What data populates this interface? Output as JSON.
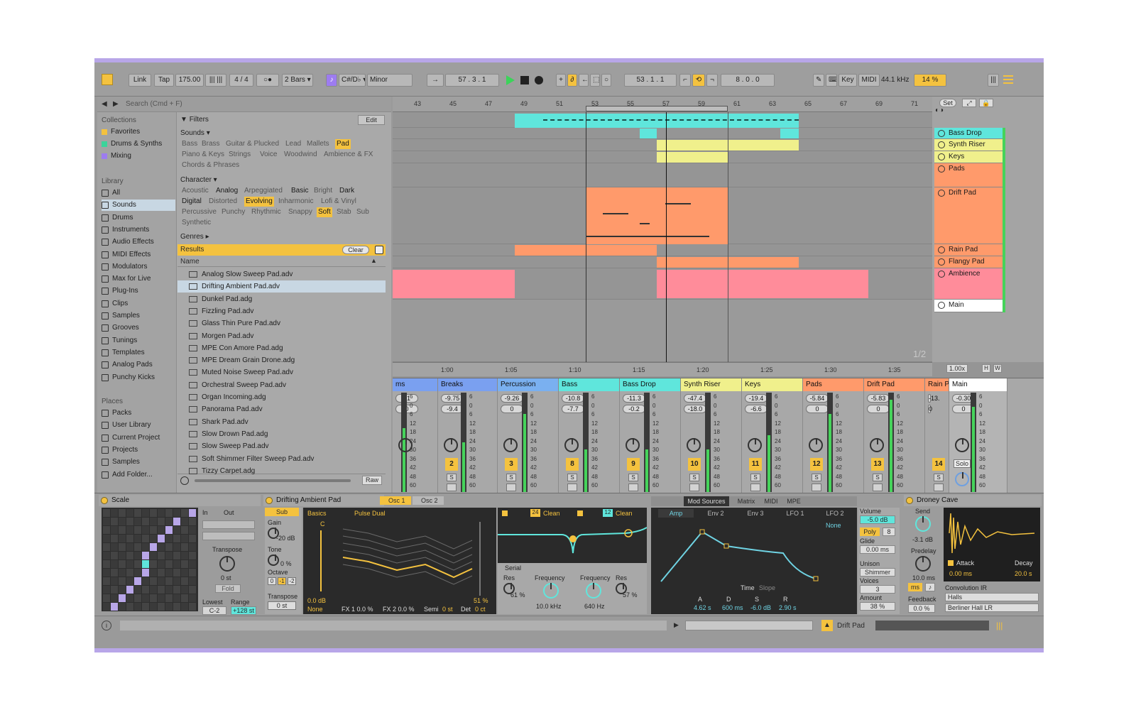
{
  "toolbar": {
    "link": "Link",
    "tap": "Tap",
    "tempo": "175.00",
    "signature": "4 / 4",
    "metronome": "○●",
    "quantize": "2 Bars ▾",
    "key_root": "C#/D♭ ▾",
    "key_mode": "Minor",
    "position": "57 .   3 .   1",
    "loop_start": "53 .   1 .   1",
    "loop_length": "8 .   0 .   0",
    "key_btn": "Key",
    "midi_btn": "MIDI",
    "sample_rate": "44.1 kHz",
    "cpu": "14 %"
  },
  "browser": {
    "search_placeholder": "Search (Cmd + F)",
    "collections_head": "Collections",
    "collections": [
      {
        "label": "Favorites",
        "color": "#f4c23f"
      },
      {
        "label": "Drums & Synths",
        "color": "#3cd39a"
      },
      {
        "label": "Mixing",
        "color": "#9d7cf0"
      }
    ],
    "library_head": "Library",
    "library": [
      "All",
      "Sounds",
      "Drums",
      "Instruments",
      "Audio Effects",
      "MIDI Effects",
      "Modulators",
      "Max for Live",
      "Plug-Ins",
      "Clips",
      "Samples",
      "Grooves",
      "Tunings",
      "Templates",
      "Analog Pads",
      "Punchy Kicks"
    ],
    "library_selected": "Sounds",
    "places_head": "Places",
    "places": [
      "Packs",
      "User Library",
      "Current Project",
      "Projects",
      "Samples",
      "Add Folder..."
    ],
    "filters_label": "Filters",
    "edit_label": "Edit",
    "sounds_head": "Sounds ▾",
    "sound_tags": [
      "Bass",
      "Brass",
      "Guitar & Plucked",
      "Lead",
      "Mallets",
      "Pad",
      "Piano & Keys",
      "Strings",
      "Voice",
      "Woodwind",
      "Ambience & FX",
      "Chords & Phrases"
    ],
    "character_head": "Character ▾",
    "character_tags": [
      "Acoustic",
      "Analog",
      "Arpeggiated",
      "Basic",
      "Bright",
      "Dark",
      "Digital",
      "Distorted",
      "Evolving",
      "Inharmonic",
      "Lofi & Vinyl",
      "Percussive",
      "Punchy",
      "Rhythmic",
      "Snappy",
      "Soft",
      "Stab",
      "Sub",
      "Synthetic"
    ],
    "genres_head": "Genres ▸",
    "results_label": "Results",
    "clear_label": "Clear",
    "name_col": "Name",
    "results": [
      "Analog Slow Sweep Pad.adv",
      "Drifting Ambient Pad.adv",
      "Dunkel Pad.adg",
      "Fizzling Pad.adv",
      "Glass Thin Pure Pad.adv",
      "Morgen Pad.adv",
      "MPE Con Amore Pad.adg",
      "MPE Dream Grain Drone.adg",
      "Muted Noise Sweep Pad.adv",
      "Orchestral Sweep Pad.adv",
      "Organ Incoming.adg",
      "Panorama Pad.adv",
      "Shark Pad.adv",
      "Slow Drown Pad.adg",
      "Slow Sweep Pad.adv",
      "Soft Shimmer Filter Sweep Pad.adv",
      "Tizzy Carpet.adg"
    ],
    "raw_label": "Raw"
  },
  "arrangement": {
    "bars": [
      "43",
      "45",
      "47",
      "49",
      "51",
      "53",
      "55",
      "57",
      "59",
      "61",
      "63",
      "65",
      "67",
      "69",
      "71"
    ],
    "times": [
      "1:00",
      "1:05",
      "1:10",
      "1:15",
      "1:20",
      "1:25",
      "1:30",
      "1:35"
    ],
    "set_label": "Set",
    "page": "1/2",
    "zoom": "1.00x",
    "tracks": [
      "Bass Drop",
      "Synth Riser",
      "Keys",
      "Pads",
      "Drift Pad",
      "Rain Pad",
      "Flangy Pad",
      "Ambience",
      "Main"
    ],
    "track_colors": [
      "#5fe6dc",
      "#f0f08c",
      "#f0f08c",
      "#ff9a6b",
      "#ff9a6b",
      "#ff9a6b",
      "#ff9a6b",
      "#ff8c9a",
      "#ffffff"
    ]
  },
  "mixer": {
    "strips": [
      {
        "name": "ms",
        "color": "#7aa0f0",
        "vol": "31",
        "pan": "0",
        "num": ""
      },
      {
        "name": "Breaks",
        "color": "#7aa0f0",
        "vol": "-9.75",
        "pan": "-9.4",
        "num": "2"
      },
      {
        "name": "Percussion",
        "color": "#7ab0f0",
        "vol": "-9.26",
        "pan": "0",
        "num": "3"
      },
      {
        "name": "Bass",
        "color": "#5fe6dc",
        "vol": "-10.8",
        "pan": "-7.7",
        "num": "8"
      },
      {
        "name": "Bass Drop",
        "color": "#5fe6dc",
        "vol": "-11.3",
        "pan": "-0.2",
        "num": "9"
      },
      {
        "name": "Synth Riser",
        "color": "#f0f08c",
        "vol": "-47.4",
        "pan": "-18.0",
        "num": "10"
      },
      {
        "name": "Keys",
        "color": "#f0f08c",
        "vol": "-19.4",
        "pan": "-6.6",
        "num": "11"
      },
      {
        "name": "Pads",
        "color": "#ff9a6b",
        "vol": "-5.84",
        "pan": "0",
        "num": "12"
      },
      {
        "name": "Drift Pad",
        "color": "#ff9a6b",
        "vol": "-5.83",
        "pan": "0",
        "num": "13"
      },
      {
        "name": "Rain P",
        "color": "#ff9a6b",
        "vol": "-13.",
        "pan": "0",
        "num": "14"
      },
      {
        "name": "Main",
        "color": "#ffffff",
        "vol": "-0.30",
        "pan": "0",
        "num": ""
      }
    ],
    "scale_marks": [
      "6",
      "0",
      "6",
      "12",
      "18",
      "24",
      "30",
      "36",
      "42",
      "48",
      "60"
    ],
    "solo_label": "Solo",
    "s_label": "S"
  },
  "devices": {
    "scale": {
      "title": "Scale",
      "in": "In",
      "out": "Out",
      "transpose": "Transpose",
      "transpose_val": "0 st",
      "fold": "Fold",
      "lowest": "Lowest",
      "range": "Range",
      "lowest_val": "C-2",
      "range_val": "+128 st"
    },
    "synth": {
      "title": "Drifting Ambient Pad",
      "osc1": "Osc 1",
      "osc2": "Osc 2",
      "sub": "Sub",
      "gain": "Gain",
      "gain_val": "-20 dB",
      "tone": "Tone",
      "tone_val": "0 %",
      "octave": "Octave",
      "oct_vals": [
        "0",
        "-1",
        "-2"
      ],
      "transpose": "Transpose",
      "transpose_val": "0 st",
      "basics": "Basics",
      "pulse": "Pulse Dual",
      "c_label": "C",
      "level_val": "0.0 dB",
      "pct_val": "51 %",
      "none_label": "None",
      "fx1": "FX 1  0.0 %",
      "fx2": "FX 2  0.0 %",
      "semi": "Semi",
      "semi_val": "0 st",
      "det": "Det",
      "det_val": "0 ct",
      "filt1": "24",
      "filt1_type": "Clean",
      "filt2": "12",
      "filt2_type": "Clean",
      "serial": "Serial",
      "res1": "Res",
      "res1_val": "61 %",
      "freq1": "Frequency",
      "freq1_val": "10.0 kHz",
      "freq2": "Frequency",
      "freq2_val": "640 Hz",
      "res2": "Res",
      "res2_val": "57 %",
      "mod_tabs": [
        "Mod Sources",
        "Matrix",
        "MIDI",
        "MPE"
      ],
      "env_tabs": [
        "Amp",
        "Env 2",
        "Env 3",
        "LFO 1",
        "LFO 2"
      ],
      "env_none": "None",
      "time": "Time",
      "slope": "Slope",
      "adsr_labels": [
        "A",
        "D",
        "S",
        "R"
      ],
      "adsr_vals": [
        "4.62 s",
        "600 ms",
        "-6.0 dB",
        "2.90 s"
      ],
      "volume": "Volume",
      "volume_val": "-5.0 dB",
      "poly": "Poly",
      "voices_n": "8",
      "glide": "Glide",
      "glide_val": "0.00 ms",
      "unison": "Unison",
      "unison_val": "Shimmer",
      "voices": "Voices",
      "voices_val": "3",
      "amount": "Amount",
      "amount_val": "38 %"
    },
    "reverb": {
      "title": "Droney Cave",
      "send": "Send",
      "send_val": "-3.1 dB",
      "predelay": "Predelay",
      "predelay_val": "10.0 ms",
      "ms": "ms",
      "attack": "Attack",
      "decay": "Decay",
      "attack_val": "0.00 ms",
      "decay_val": "20.0 s",
      "ir": "Convolution IR",
      "ir_cat": "Halls",
      "ir_name": "Berliner Hall LR",
      "feedback": "Feedback",
      "feedback_val": "0.0 %"
    }
  },
  "status": {
    "track": "Drift Pad"
  },
  "colors": {
    "accent": "#f4c23f",
    "cyan": "#5fe6dc",
    "orange": "#ff9a6b",
    "pink": "#ff8c9a",
    "yellow": "#f0f08c",
    "purple": "#b8a6e8"
  }
}
